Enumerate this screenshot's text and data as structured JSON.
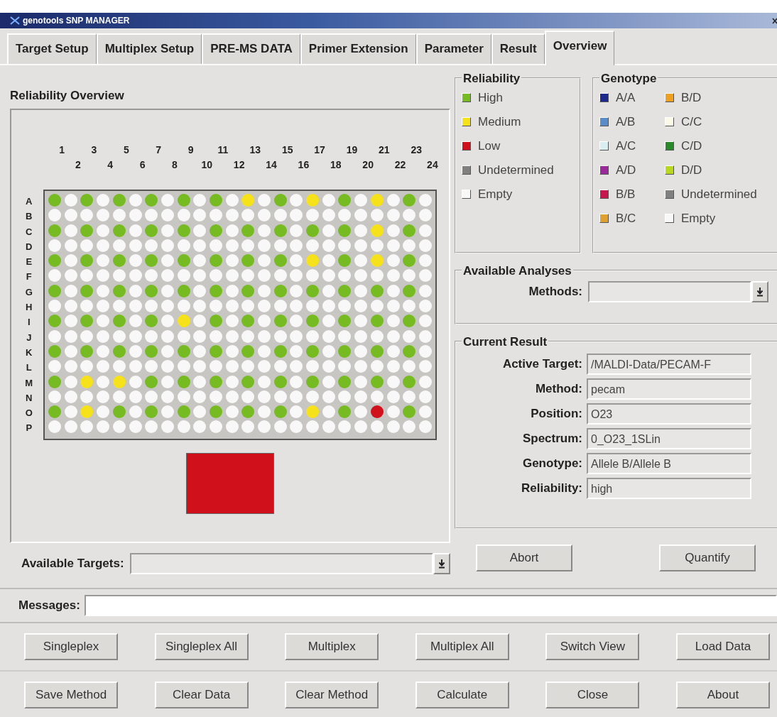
{
  "window": {
    "title": "genotools SNP MANAGER"
  },
  "tabs": [
    {
      "label": "Target Setup",
      "selected": false
    },
    {
      "label": "Multiplex Setup",
      "selected": false
    },
    {
      "label": "PRE-MS DATA",
      "selected": false
    },
    {
      "label": "Primer Extension",
      "selected": false
    },
    {
      "label": "Parameter",
      "selected": false
    },
    {
      "label": "Result",
      "selected": false
    },
    {
      "label": "Overview",
      "selected": true
    }
  ],
  "overview": {
    "title": "Reliability Overview",
    "columns": [
      "1",
      "2",
      "3",
      "4",
      "5",
      "6",
      "7",
      "8",
      "9",
      "10",
      "11",
      "12",
      "13",
      "14",
      "15",
      "16",
      "17",
      "18",
      "19",
      "20",
      "21",
      "22",
      "23",
      "24"
    ],
    "rows": [
      {
        "label": "A",
        "wells": [
          {
            "kind": "high"
          },
          {
            "kind": "empty"
          },
          {
            "kind": "high"
          },
          {
            "kind": "empty"
          },
          {
            "kind": "high"
          },
          {
            "kind": "empty"
          },
          {
            "kind": "high"
          },
          {
            "kind": "empty"
          },
          {
            "kind": "high"
          },
          {
            "kind": "empty"
          },
          {
            "kind": "high"
          },
          {
            "kind": "empty"
          },
          {
            "kind": "medium"
          },
          {
            "kind": "empty"
          },
          {
            "kind": "high"
          },
          {
            "kind": "empty"
          },
          {
            "kind": "medium"
          },
          {
            "kind": "empty"
          },
          {
            "kind": "high"
          },
          {
            "kind": "empty"
          },
          {
            "kind": "medium"
          },
          {
            "kind": "empty"
          },
          {
            "kind": "high"
          },
          {
            "kind": "empty"
          }
        ]
      },
      {
        "label": "B",
        "wells": [
          {
            "kind": "empty"
          },
          {
            "kind": "empty"
          },
          {
            "kind": "empty"
          },
          {
            "kind": "empty"
          },
          {
            "kind": "empty"
          },
          {
            "kind": "empty"
          },
          {
            "kind": "empty"
          },
          {
            "kind": "empty"
          },
          {
            "kind": "empty"
          },
          {
            "kind": "empty"
          },
          {
            "kind": "empty"
          },
          {
            "kind": "empty"
          },
          {
            "kind": "empty"
          },
          {
            "kind": "empty"
          },
          {
            "kind": "empty"
          },
          {
            "kind": "empty"
          },
          {
            "kind": "empty"
          },
          {
            "kind": "empty"
          },
          {
            "kind": "empty"
          },
          {
            "kind": "empty"
          },
          {
            "kind": "empty"
          },
          {
            "kind": "empty"
          },
          {
            "kind": "empty"
          },
          {
            "kind": "empty"
          }
        ]
      },
      {
        "label": "C",
        "wells": [
          {
            "kind": "high"
          },
          {
            "kind": "empty"
          },
          {
            "kind": "high"
          },
          {
            "kind": "empty"
          },
          {
            "kind": "high"
          },
          {
            "kind": "empty"
          },
          {
            "kind": "high"
          },
          {
            "kind": "empty"
          },
          {
            "kind": "high"
          },
          {
            "kind": "empty"
          },
          {
            "kind": "high"
          },
          {
            "kind": "empty"
          },
          {
            "kind": "high"
          },
          {
            "kind": "empty"
          },
          {
            "kind": "high"
          },
          {
            "kind": "empty"
          },
          {
            "kind": "high"
          },
          {
            "kind": "empty"
          },
          {
            "kind": "high"
          },
          {
            "kind": "empty"
          },
          {
            "kind": "medium"
          },
          {
            "kind": "empty"
          },
          {
            "kind": "high"
          },
          {
            "kind": "empty"
          }
        ]
      },
      {
        "label": "D",
        "wells": [
          {
            "kind": "empty"
          },
          {
            "kind": "empty"
          },
          {
            "kind": "empty"
          },
          {
            "kind": "empty"
          },
          {
            "kind": "empty"
          },
          {
            "kind": "empty"
          },
          {
            "kind": "empty"
          },
          {
            "kind": "empty"
          },
          {
            "kind": "empty"
          },
          {
            "kind": "empty"
          },
          {
            "kind": "empty"
          },
          {
            "kind": "empty"
          },
          {
            "kind": "empty"
          },
          {
            "kind": "empty"
          },
          {
            "kind": "empty"
          },
          {
            "kind": "empty"
          },
          {
            "kind": "empty"
          },
          {
            "kind": "empty"
          },
          {
            "kind": "empty"
          },
          {
            "kind": "empty"
          },
          {
            "kind": "empty"
          },
          {
            "kind": "empty"
          },
          {
            "kind": "empty"
          },
          {
            "kind": "empty"
          }
        ]
      },
      {
        "label": "E",
        "wells": [
          {
            "kind": "high"
          },
          {
            "kind": "empty"
          },
          {
            "kind": "high"
          },
          {
            "kind": "empty"
          },
          {
            "kind": "high"
          },
          {
            "kind": "empty"
          },
          {
            "kind": "high"
          },
          {
            "kind": "empty"
          },
          {
            "kind": "high"
          },
          {
            "kind": "empty"
          },
          {
            "kind": "high"
          },
          {
            "kind": "empty"
          },
          {
            "kind": "high"
          },
          {
            "kind": "empty"
          },
          {
            "kind": "high"
          },
          {
            "kind": "empty"
          },
          {
            "kind": "medium"
          },
          {
            "kind": "empty"
          },
          {
            "kind": "high"
          },
          {
            "kind": "empty"
          },
          {
            "kind": "medium"
          },
          {
            "kind": "empty"
          },
          {
            "kind": "high"
          },
          {
            "kind": "empty"
          }
        ]
      },
      {
        "label": "F",
        "wells": [
          {
            "kind": "empty"
          },
          {
            "kind": "empty"
          },
          {
            "kind": "empty"
          },
          {
            "kind": "empty"
          },
          {
            "kind": "empty"
          },
          {
            "kind": "empty"
          },
          {
            "kind": "empty"
          },
          {
            "kind": "empty"
          },
          {
            "kind": "empty"
          },
          {
            "kind": "empty"
          },
          {
            "kind": "empty"
          },
          {
            "kind": "empty"
          },
          {
            "kind": "empty"
          },
          {
            "kind": "empty"
          },
          {
            "kind": "empty"
          },
          {
            "kind": "empty"
          },
          {
            "kind": "empty"
          },
          {
            "kind": "empty"
          },
          {
            "kind": "empty"
          },
          {
            "kind": "empty"
          },
          {
            "kind": "empty"
          },
          {
            "kind": "empty"
          },
          {
            "kind": "empty"
          },
          {
            "kind": "empty"
          }
        ]
      },
      {
        "label": "G",
        "wells": [
          {
            "kind": "high"
          },
          {
            "kind": "empty"
          },
          {
            "kind": "high"
          },
          {
            "kind": "empty"
          },
          {
            "kind": "high"
          },
          {
            "kind": "empty"
          },
          {
            "kind": "high"
          },
          {
            "kind": "empty"
          },
          {
            "kind": "high"
          },
          {
            "kind": "empty"
          },
          {
            "kind": "high"
          },
          {
            "kind": "empty"
          },
          {
            "kind": "high"
          },
          {
            "kind": "empty"
          },
          {
            "kind": "high"
          },
          {
            "kind": "empty"
          },
          {
            "kind": "high"
          },
          {
            "kind": "empty"
          },
          {
            "kind": "high"
          },
          {
            "kind": "empty"
          },
          {
            "kind": "high"
          },
          {
            "kind": "empty"
          },
          {
            "kind": "high"
          },
          {
            "kind": "empty"
          }
        ]
      },
      {
        "label": "H",
        "wells": [
          {
            "kind": "empty"
          },
          {
            "kind": "empty"
          },
          {
            "kind": "empty"
          },
          {
            "kind": "empty"
          },
          {
            "kind": "empty"
          },
          {
            "kind": "empty"
          },
          {
            "kind": "empty"
          },
          {
            "kind": "empty"
          },
          {
            "kind": "empty"
          },
          {
            "kind": "empty"
          },
          {
            "kind": "empty"
          },
          {
            "kind": "empty"
          },
          {
            "kind": "empty"
          },
          {
            "kind": "empty"
          },
          {
            "kind": "empty"
          },
          {
            "kind": "empty"
          },
          {
            "kind": "empty"
          },
          {
            "kind": "empty"
          },
          {
            "kind": "empty"
          },
          {
            "kind": "empty"
          },
          {
            "kind": "empty"
          },
          {
            "kind": "empty"
          },
          {
            "kind": "empty"
          },
          {
            "kind": "empty"
          }
        ]
      },
      {
        "label": "I",
        "wells": [
          {
            "kind": "high"
          },
          {
            "kind": "empty"
          },
          {
            "kind": "high"
          },
          {
            "kind": "empty"
          },
          {
            "kind": "high"
          },
          {
            "kind": "empty"
          },
          {
            "kind": "high"
          },
          {
            "kind": "empty"
          },
          {
            "kind": "medium"
          },
          {
            "kind": "empty"
          },
          {
            "kind": "high"
          },
          {
            "kind": "empty"
          },
          {
            "kind": "high"
          },
          {
            "kind": "empty"
          },
          {
            "kind": "high"
          },
          {
            "kind": "empty"
          },
          {
            "kind": "high"
          },
          {
            "kind": "empty"
          },
          {
            "kind": "high"
          },
          {
            "kind": "empty"
          },
          {
            "kind": "high"
          },
          {
            "kind": "empty"
          },
          {
            "kind": "high"
          },
          {
            "kind": "empty"
          }
        ]
      },
      {
        "label": "J",
        "wells": [
          {
            "kind": "empty"
          },
          {
            "kind": "empty"
          },
          {
            "kind": "empty"
          },
          {
            "kind": "empty"
          },
          {
            "kind": "empty"
          },
          {
            "kind": "empty"
          },
          {
            "kind": "empty"
          },
          {
            "kind": "empty"
          },
          {
            "kind": "empty"
          },
          {
            "kind": "empty"
          },
          {
            "kind": "empty"
          },
          {
            "kind": "empty"
          },
          {
            "kind": "empty"
          },
          {
            "kind": "empty"
          },
          {
            "kind": "empty"
          },
          {
            "kind": "empty"
          },
          {
            "kind": "empty"
          },
          {
            "kind": "empty"
          },
          {
            "kind": "empty"
          },
          {
            "kind": "empty"
          },
          {
            "kind": "empty"
          },
          {
            "kind": "empty"
          },
          {
            "kind": "empty"
          },
          {
            "kind": "empty"
          }
        ]
      },
      {
        "label": "K",
        "wells": [
          {
            "kind": "high"
          },
          {
            "kind": "empty"
          },
          {
            "kind": "high"
          },
          {
            "kind": "empty"
          },
          {
            "kind": "high"
          },
          {
            "kind": "empty"
          },
          {
            "kind": "high"
          },
          {
            "kind": "empty"
          },
          {
            "kind": "high"
          },
          {
            "kind": "empty"
          },
          {
            "kind": "high"
          },
          {
            "kind": "empty"
          },
          {
            "kind": "high"
          },
          {
            "kind": "empty"
          },
          {
            "kind": "high"
          },
          {
            "kind": "empty"
          },
          {
            "kind": "high"
          },
          {
            "kind": "empty"
          },
          {
            "kind": "high"
          },
          {
            "kind": "empty"
          },
          {
            "kind": "high"
          },
          {
            "kind": "empty"
          },
          {
            "kind": "high"
          },
          {
            "kind": "empty"
          }
        ]
      },
      {
        "label": "L",
        "wells": [
          {
            "kind": "empty"
          },
          {
            "kind": "empty"
          },
          {
            "kind": "empty"
          },
          {
            "kind": "empty"
          },
          {
            "kind": "empty"
          },
          {
            "kind": "empty"
          },
          {
            "kind": "empty"
          },
          {
            "kind": "empty"
          },
          {
            "kind": "empty"
          },
          {
            "kind": "empty"
          },
          {
            "kind": "empty"
          },
          {
            "kind": "empty"
          },
          {
            "kind": "empty"
          },
          {
            "kind": "empty"
          },
          {
            "kind": "empty"
          },
          {
            "kind": "empty"
          },
          {
            "kind": "empty"
          },
          {
            "kind": "empty"
          },
          {
            "kind": "empty"
          },
          {
            "kind": "empty"
          },
          {
            "kind": "empty"
          },
          {
            "kind": "empty"
          },
          {
            "kind": "empty"
          },
          {
            "kind": "empty"
          }
        ]
      },
      {
        "label": "M",
        "wells": [
          {
            "kind": "high"
          },
          {
            "kind": "empty"
          },
          {
            "kind": "medium"
          },
          {
            "kind": "empty"
          },
          {
            "kind": "medium"
          },
          {
            "kind": "empty"
          },
          {
            "kind": "high"
          },
          {
            "kind": "empty"
          },
          {
            "kind": "high"
          },
          {
            "kind": "empty"
          },
          {
            "kind": "high"
          },
          {
            "kind": "empty"
          },
          {
            "kind": "high"
          },
          {
            "kind": "empty"
          },
          {
            "kind": "high"
          },
          {
            "kind": "empty"
          },
          {
            "kind": "high"
          },
          {
            "kind": "empty"
          },
          {
            "kind": "high"
          },
          {
            "kind": "empty"
          },
          {
            "kind": "high"
          },
          {
            "kind": "empty"
          },
          {
            "kind": "high"
          },
          {
            "kind": "empty"
          }
        ]
      },
      {
        "label": "N",
        "wells": [
          {
            "kind": "empty"
          },
          {
            "kind": "empty"
          },
          {
            "kind": "empty"
          },
          {
            "kind": "empty"
          },
          {
            "kind": "empty"
          },
          {
            "kind": "empty"
          },
          {
            "kind": "empty"
          },
          {
            "kind": "empty"
          },
          {
            "kind": "empty"
          },
          {
            "kind": "empty"
          },
          {
            "kind": "empty"
          },
          {
            "kind": "empty"
          },
          {
            "kind": "empty"
          },
          {
            "kind": "empty"
          },
          {
            "kind": "empty"
          },
          {
            "kind": "empty"
          },
          {
            "kind": "empty"
          },
          {
            "kind": "empty"
          },
          {
            "kind": "empty"
          },
          {
            "kind": "empty"
          },
          {
            "kind": "empty"
          },
          {
            "kind": "empty"
          },
          {
            "kind": "empty"
          },
          {
            "kind": "empty"
          }
        ]
      },
      {
        "label": "O",
        "wells": [
          {
            "kind": "high"
          },
          {
            "kind": "empty"
          },
          {
            "kind": "medium"
          },
          {
            "kind": "empty"
          },
          {
            "kind": "high"
          },
          {
            "kind": "empty"
          },
          {
            "kind": "high"
          },
          {
            "kind": "empty"
          },
          {
            "kind": "high"
          },
          {
            "kind": "empty"
          },
          {
            "kind": "high"
          },
          {
            "kind": "empty"
          },
          {
            "kind": "high"
          },
          {
            "kind": "empty"
          },
          {
            "kind": "high"
          },
          {
            "kind": "empty"
          },
          {
            "kind": "medium"
          },
          {
            "kind": "empty"
          },
          {
            "kind": "high"
          },
          {
            "kind": "empty"
          },
          {
            "kind": "low"
          },
          {
            "kind": "empty"
          },
          {
            "kind": "high"
          },
          {
            "kind": "empty"
          }
        ]
      },
      {
        "label": "P",
        "wells": [
          {
            "kind": "empty"
          },
          {
            "kind": "empty"
          },
          {
            "kind": "empty"
          },
          {
            "kind": "empty"
          },
          {
            "kind": "empty"
          },
          {
            "kind": "empty"
          },
          {
            "kind": "empty"
          },
          {
            "kind": "empty"
          },
          {
            "kind": "empty"
          },
          {
            "kind": "empty"
          },
          {
            "kind": "empty"
          },
          {
            "kind": "empty"
          },
          {
            "kind": "empty"
          },
          {
            "kind": "empty"
          },
          {
            "kind": "empty"
          },
          {
            "kind": "empty"
          },
          {
            "kind": "empty"
          },
          {
            "kind": "empty"
          },
          {
            "kind": "empty"
          },
          {
            "kind": "empty"
          },
          {
            "kind": "empty"
          },
          {
            "kind": "empty"
          },
          {
            "kind": "empty"
          },
          {
            "kind": "empty"
          }
        ]
      }
    ],
    "preview": {
      "color": "#d0101a"
    }
  },
  "available_targets": {
    "label": "Available Targets:"
  },
  "reliability_legend": {
    "title": "Reliability",
    "items": [
      {
        "kind": "high",
        "label": "High",
        "color": "#77bb22"
      },
      {
        "kind": "medium",
        "label": "Medium",
        "color": "#f5e21a"
      },
      {
        "kind": "low",
        "label": "Low",
        "color": "#d0101a"
      },
      {
        "kind": "undetermined",
        "label": "Undetermined",
        "color": "#808080"
      },
      {
        "kind": "empty",
        "label": "Empty",
        "color": "#f8f8f8"
      }
    ]
  },
  "genotype_legend": {
    "title": "Genotype",
    "items": [
      {
        "label": "A/A",
        "color": "#1c2a8c"
      },
      {
        "label": "B/D",
        "color": "#f0a020"
      },
      {
        "label": "A/B",
        "color": "#5a8cc8"
      },
      {
        "label": "C/C",
        "color": "#fafae6"
      },
      {
        "label": "A/C",
        "color": "#d8eef0"
      },
      {
        "label": "C/D",
        "color": "#2a8a2a"
      },
      {
        "label": "A/D",
        "color": "#9a2a9a"
      },
      {
        "label": "D/D",
        "color": "#b8d820"
      },
      {
        "label": "B/B",
        "color": "#c81850"
      },
      {
        "label": "Undetermined",
        "color": "#808080"
      },
      {
        "label": "B/C",
        "color": "#e0a030"
      },
      {
        "label": "Empty",
        "color": "#f8f8f8"
      }
    ]
  },
  "available_analyses": {
    "title": "Available Analyses",
    "methods_label": "Methods:"
  },
  "current_result": {
    "title": "Current Result",
    "fields": [
      {
        "label": "Active Target:",
        "value": "/MALDI-Data/PECAM-F"
      },
      {
        "label": "Method:",
        "value": "pecam"
      },
      {
        "label": "Position:",
        "value": "O23"
      },
      {
        "label": "Spectrum:",
        "value": "0_O23_1SLin"
      },
      {
        "label": "Genotype:",
        "value": "Allele B/Allele B"
      },
      {
        "label": "Reliability:",
        "value": "high"
      }
    ]
  },
  "action_buttons": [
    "Abort",
    "Quantify"
  ],
  "messages": {
    "label": "Messages:"
  },
  "button_rows": [
    [
      "Singleplex",
      "Singleplex All",
      "Multiplex",
      "Multiplex All",
      "Switch View",
      "Load Data"
    ],
    [
      "Save Method",
      "Clear Data",
      "Clear Method",
      "Calculate",
      "Close",
      "About"
    ]
  ]
}
